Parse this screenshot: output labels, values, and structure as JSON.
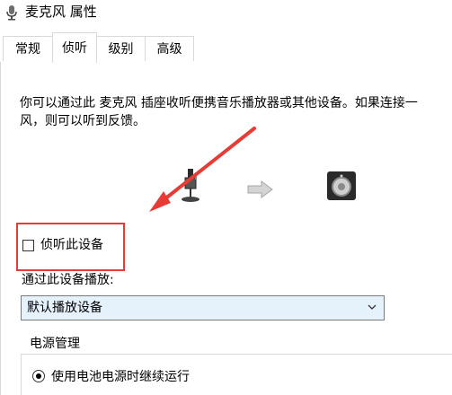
{
  "window": {
    "title": "麦克风 属性",
    "icon": "microphone-icon"
  },
  "tabs": [
    {
      "label": "常规",
      "active": false
    },
    {
      "label": "侦听",
      "active": true
    },
    {
      "label": "级别",
      "active": false
    },
    {
      "label": "高级",
      "active": false
    }
  ],
  "listen": {
    "description": "你可以通过此 麦克风 插座收听便携音乐播放器或其他设备。如果连接一\n风，则可以听到反馈。",
    "checkbox_label": "侦听此设备",
    "checkbox_checked": false,
    "playback_label": "通过此设备播放:",
    "playback_device": "默认播放设备"
  },
  "power": {
    "group_title": "电源管理",
    "option_label": "使用电池电源时继续运行",
    "option_selected": true
  },
  "colors": {
    "annotation": "#e83b35",
    "select_bg": "#e5f1fb"
  }
}
